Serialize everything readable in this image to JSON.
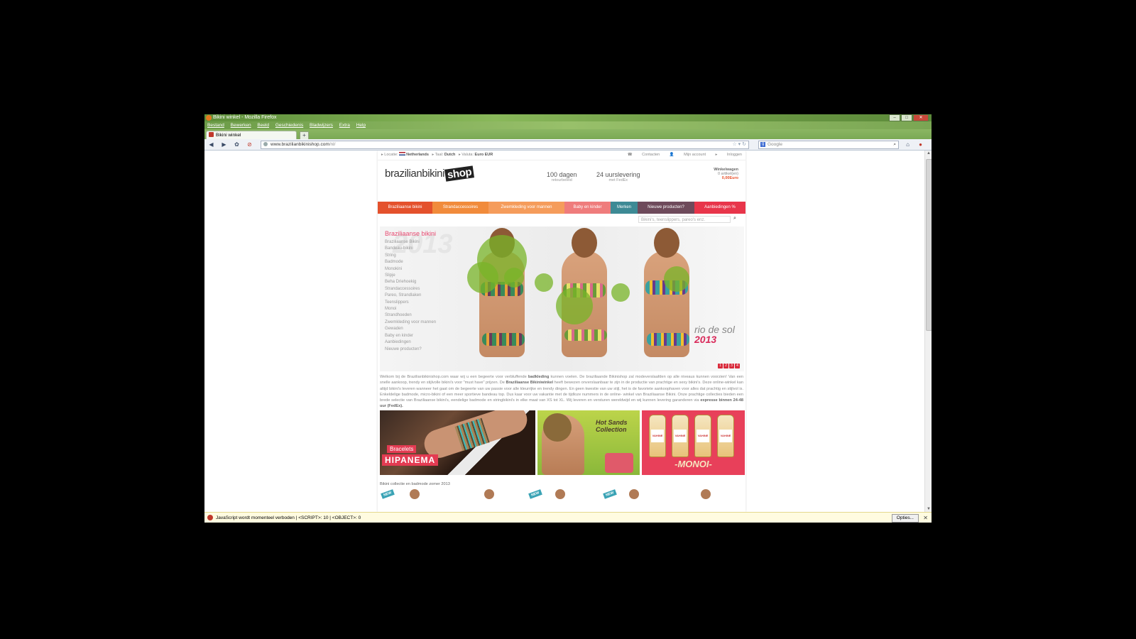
{
  "browser": {
    "window_title": "Bikini winkel - Mozilla Firefox",
    "menu": [
      "Bestand",
      "Bewerken",
      "Beeld",
      "Geschiedenis",
      "Bladwijzers",
      "Extra",
      "Help"
    ],
    "tab_title": "Bikini winkel",
    "new_tab": "+",
    "url_host": "www.brazilianbikinishop.com",
    "url_path": "/nl/",
    "search_placeholder": "Google",
    "status_message": "JavaScript wordt momenteel verboden | <SCRIPT>: 10 | <OBJECT>: 0",
    "options_button": "Opties..."
  },
  "site": {
    "topbar": {
      "locatie_label": "Locatie:",
      "locatie_value": "Netherlands",
      "taal_label": "Taal:",
      "taal_value": "Dutch",
      "valuta_label": "Valuta:",
      "valuta_value": "Euro EUR",
      "contacten": "Contacten",
      "mijn_account": "Mijn account",
      "inloggen": "Inloggen"
    },
    "logo_text": "brazilianbikini",
    "logo_shop": "shop",
    "usp1_big": "100 dagen",
    "usp1_small": "retourbeleid",
    "usp2_big": "24 uurslevering",
    "usp2_small": "met FedEx",
    "cart_title": "Winkelwagen",
    "cart_items": "0 artikel(en)",
    "cart_price": "0,00Euro",
    "nav": [
      {
        "label": "Braziliaanse bikini",
        "color": "#e4512c"
      },
      {
        "label": "Strandaccessoires",
        "color": "#f18b3b"
      },
      {
        "label": "Zwemkleding voor mannen",
        "color": "#f59c5b"
      },
      {
        "label": "Baby en kinder",
        "color": "#ef7c7c"
      },
      {
        "label": "Merken",
        "color": "#3d8a95"
      },
      {
        "label": "Nieuwe producten?",
        "color": "#6e4a5b"
      },
      {
        "label": "Aanbiedingen %",
        "color": "#e8354a"
      }
    ],
    "search_placeholder": "Bikini's, teenslippers, pareo's enz.",
    "category_heading": "Braziliaanse bikini",
    "categories": [
      "Braziliaanse Bikini",
      "Bandeau-bikini",
      "String",
      "Badmode",
      "Monokini",
      "Slipje",
      "Beha Driehoekig",
      "Strandaccessoires",
      "Pareo, Strandlaken",
      "Teenslippers",
      "Monoi",
      "Strandhoeden",
      "Zwemkleding voor mannen",
      "Gewaden",
      "Baby en kinder",
      "Aanbiedingen",
      "Nieuwe producten?"
    ],
    "hero_watermark": "2013",
    "hero_brand": "rio de sol",
    "hero_year": "2013",
    "slider_dots": [
      "1",
      "2",
      "3",
      "4"
    ],
    "intro_1": "Welkom bij de Brazilianbikinishop.com waar wij u een begeerte voor verbluffende ",
    "intro_b1": "badkleding",
    "intro_2": " kunnen voelen. De braziliaande Bikinishop zal modeverslaafden op alle niveaus kunnen voorzien! Van een snelle aankoop, trendy en stijlvolle bikini's voor \"must have\" prijzen. De ",
    "intro_b2": "Braziliaanse Bikiniwinkel",
    "intro_3": " heeft bewezen onverslaanbaar te zijn in de productie van prachtige en sexy bikini's. Deze online-winkel kan altijd bikini's leveren wanneer het gaat om de begeerte van uw passie voor alle kleurrijke en trendy dingen. En geen kwestie van uw stijl, het is de favoriete aankoophaven voor alles dat prachtig en stijlvol is. Enkeldelige badmode, micro-bikini of een meer sportieve bandeau top. Dus kaar voor uw vakantie met de tijdloze nummers in de online- winkel van Braziliaanse Bikini. Onze prachtige collecties bieden een brede selectie van Braziliaanse bikini's, eendelige badmode en stringbikini's in elke maat van XS tot XL. Wij leveren en versturen wereldwijd en wij kunnen levering garanderen via ",
    "intro_b3": "expresse binnen 24-48 uur (FedEx).",
    "banner1_label1": "Bracelets",
    "banner1_label2": "HIPANEMA",
    "banner2_text": "Hot Sands Collection",
    "banner3_bottle": "VAHINE",
    "banner3_text": "-MONOI-",
    "section_title": "Bikini collectie en badmode zomer 2013",
    "new_badge": "NEW"
  }
}
